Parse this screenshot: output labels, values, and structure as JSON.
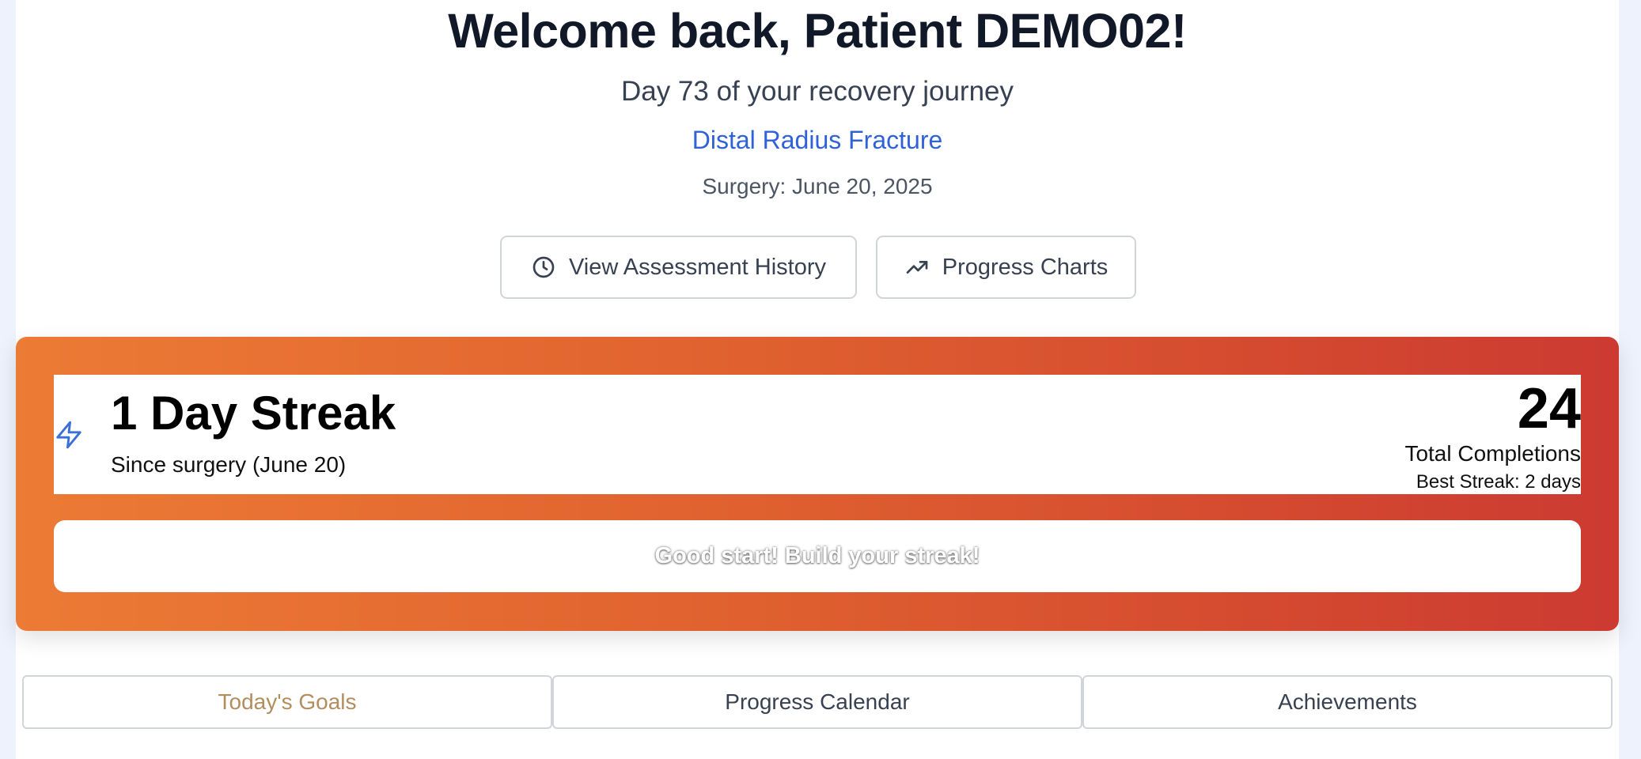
{
  "header": {
    "welcome": "Welcome back, Patient DEMO02!",
    "day_text": "Day 73 of your recovery journey",
    "condition": "Distal Radius Fracture",
    "surgery": "Surgery: June 20, 2025"
  },
  "actions": {
    "history_label": "View Assessment History",
    "history_icon": "clock-icon",
    "charts_label": "Progress Charts",
    "charts_icon": "trending-up-icon"
  },
  "streak": {
    "icon": "lightning-icon",
    "title": "1 Day Streak",
    "subtitle": "Since surgery (June 20)",
    "total_completions": "24",
    "total_label": "Total Completions",
    "best_streak": "Best Streak: 2 days",
    "message": "Good start! Build your streak!",
    "gradient_start": "#ec7b35",
    "gradient_end": "#cc3a31"
  },
  "tabs": [
    {
      "label": "Today's Goals",
      "active": true
    },
    {
      "label": "Progress Calendar",
      "active": false
    },
    {
      "label": "Achievements",
      "active": false
    }
  ],
  "colors": {
    "accent": "#2f62d6",
    "active_tab": "#b38d5e"
  }
}
